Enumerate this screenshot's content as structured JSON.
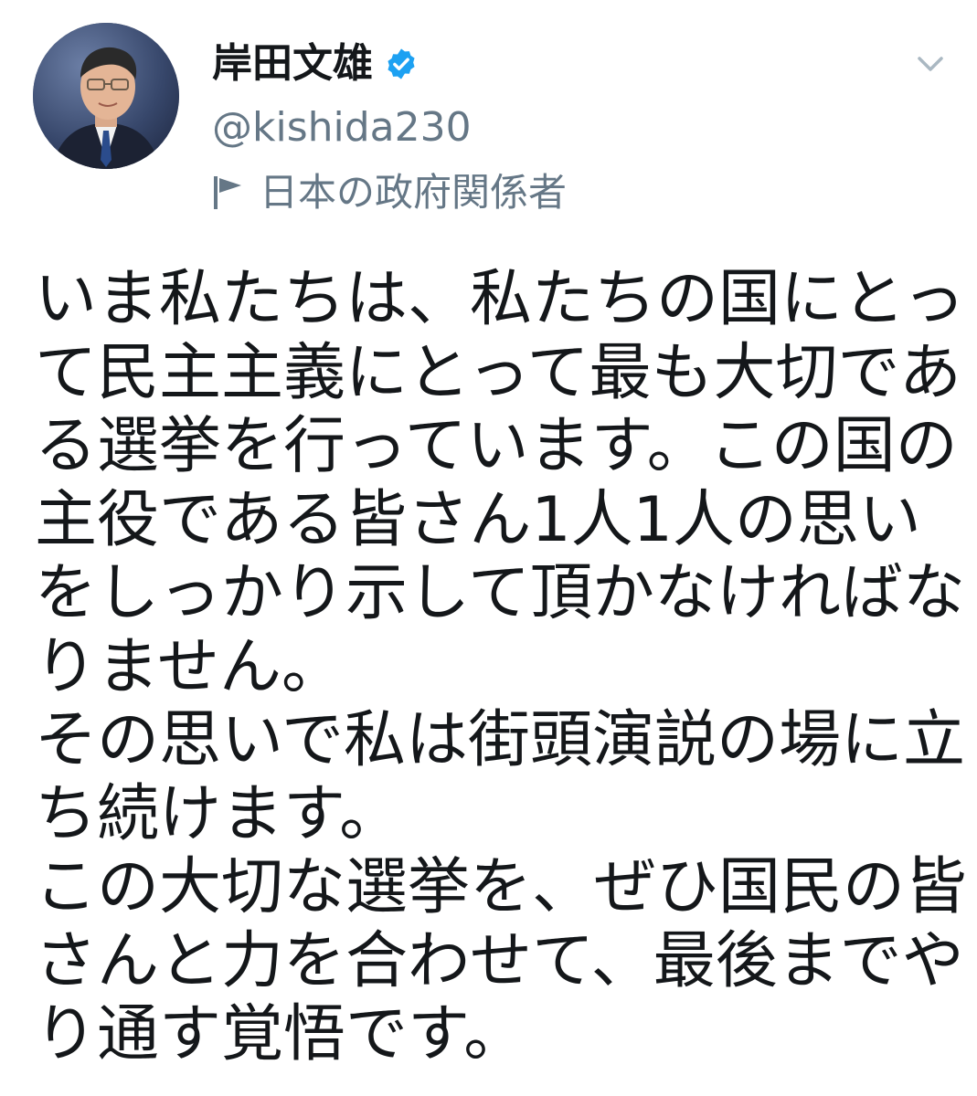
{
  "tweet": {
    "author": {
      "display_name": "岸田文雄",
      "handle": "@kishida230",
      "verified_icon": "verified-badge-icon",
      "label": "日本の政府関係者",
      "label_icon": "flag-icon"
    },
    "menu_icon": "chevron-down-icon",
    "body_lines": [
      "いま私たちは、私たちの国にとっ",
      "て民主主義にとって最も大切であ",
      "る選挙を行っています。この国の",
      "主役である皆さん1人1人の思い",
      "をしっかり示して頂かなければな",
      "りません。",
      "その思いで私は街頭演説の場に立",
      "ち続けます。",
      "この大切な選挙を、ぜひ国民の皆",
      "さんと力を合わせて、最後までや",
      "り通す覚悟です。"
    ]
  },
  "colors": {
    "text": "#14171a",
    "secondary": "#657786",
    "verified_blue": "#1da1f2"
  }
}
